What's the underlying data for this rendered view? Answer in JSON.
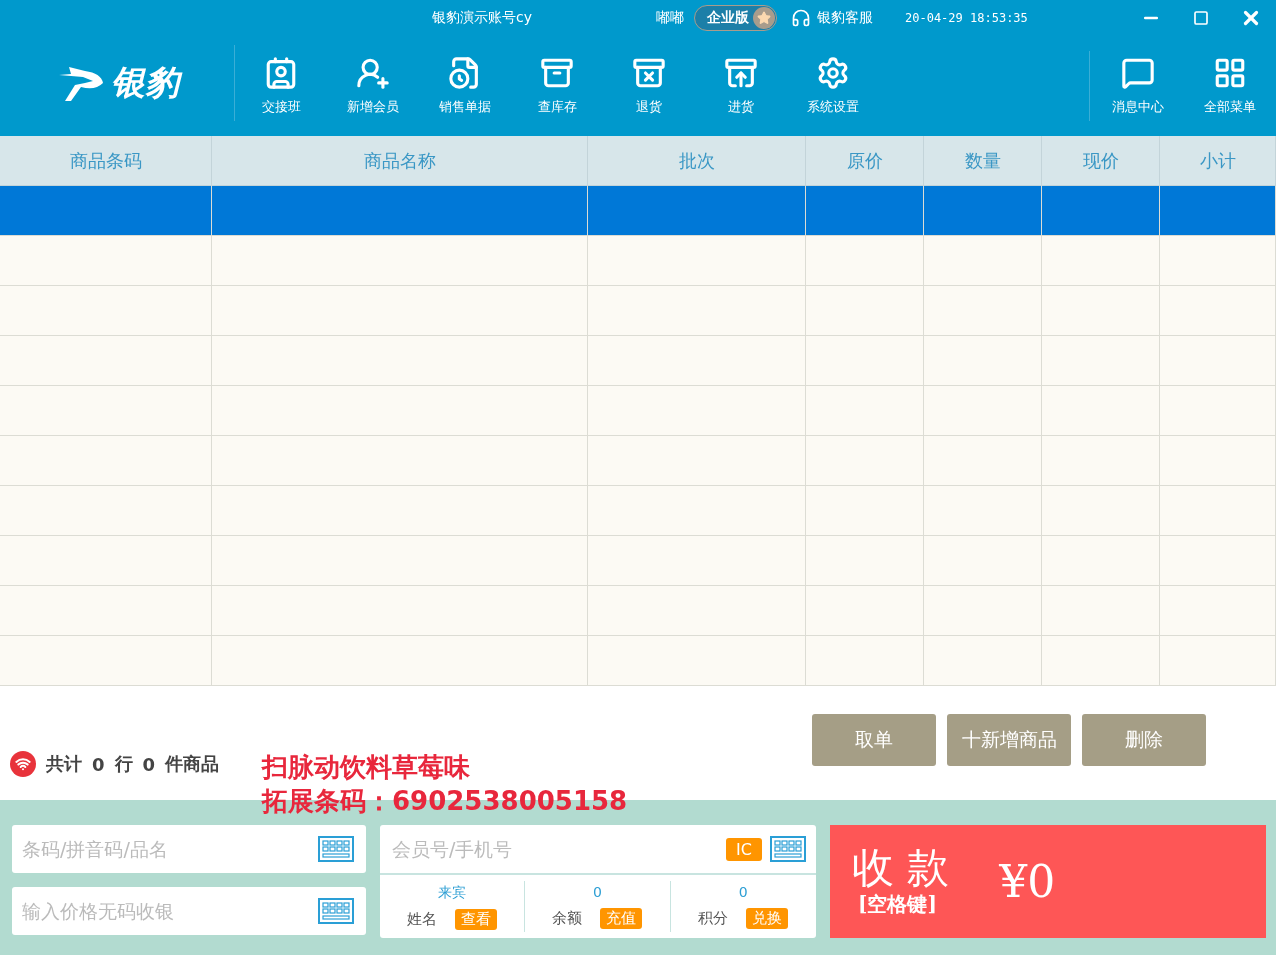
{
  "window": {
    "title": "银豹演示账号cy",
    "user": "嘟嘟",
    "edition": "企业版",
    "support": "银豹客服",
    "datetime": "20-04-29 18:53:35"
  },
  "logo": {
    "text": "银豹"
  },
  "toolbar": [
    {
      "label": "交接班",
      "kind": "shift"
    },
    {
      "label": "新增会员",
      "kind": "member"
    },
    {
      "label": "销售单据",
      "kind": "receipt"
    },
    {
      "label": "查库存",
      "kind": "stock"
    },
    {
      "label": "退货",
      "kind": "return"
    },
    {
      "label": "进货",
      "kind": "purchase"
    },
    {
      "label": "系统设置",
      "kind": "settings"
    }
  ],
  "toolbar_right": [
    {
      "label": "消息中心",
      "kind": "message"
    },
    {
      "label": "全部菜单",
      "kind": "menu"
    }
  ],
  "table": {
    "columns": [
      "商品条码",
      "商品名称",
      "批次",
      "原价",
      "数量",
      "现价",
      "小计"
    ],
    "rows": [
      {
        "selected": true
      },
      {
        "selected": false
      },
      {
        "selected": false
      },
      {
        "selected": false
      },
      {
        "selected": false
      },
      {
        "selected": false
      },
      {
        "selected": false
      },
      {
        "selected": false
      },
      {
        "selected": false
      },
      {
        "selected": false
      }
    ]
  },
  "summary": {
    "label_total": "共计",
    "rows": "0",
    "label_rows": "行",
    "items": "0",
    "label_items": "件商品"
  },
  "scan_notice": [
    "扫脉动饮料草莓味",
    "拓展条码：6902538005158"
  ],
  "actions": [
    "取单",
    "十新增商品",
    "删除"
  ],
  "search": {
    "placeholder": "条码/拼音码/品名"
  },
  "price_input": {
    "placeholder": "输入价格无码收银"
  },
  "member": {
    "placeholder": "会员号/手机号",
    "ic_button": "IC",
    "stats": [
      {
        "value": "来宾",
        "label": "姓名",
        "button": "查看"
      },
      {
        "value": "0",
        "label": "余额",
        "button": "充值"
      },
      {
        "value": "0",
        "label": "积分",
        "button": "兑换"
      }
    ]
  },
  "checkout": {
    "title": "收 款",
    "hint": "[空格键]",
    "amount": "¥0"
  }
}
